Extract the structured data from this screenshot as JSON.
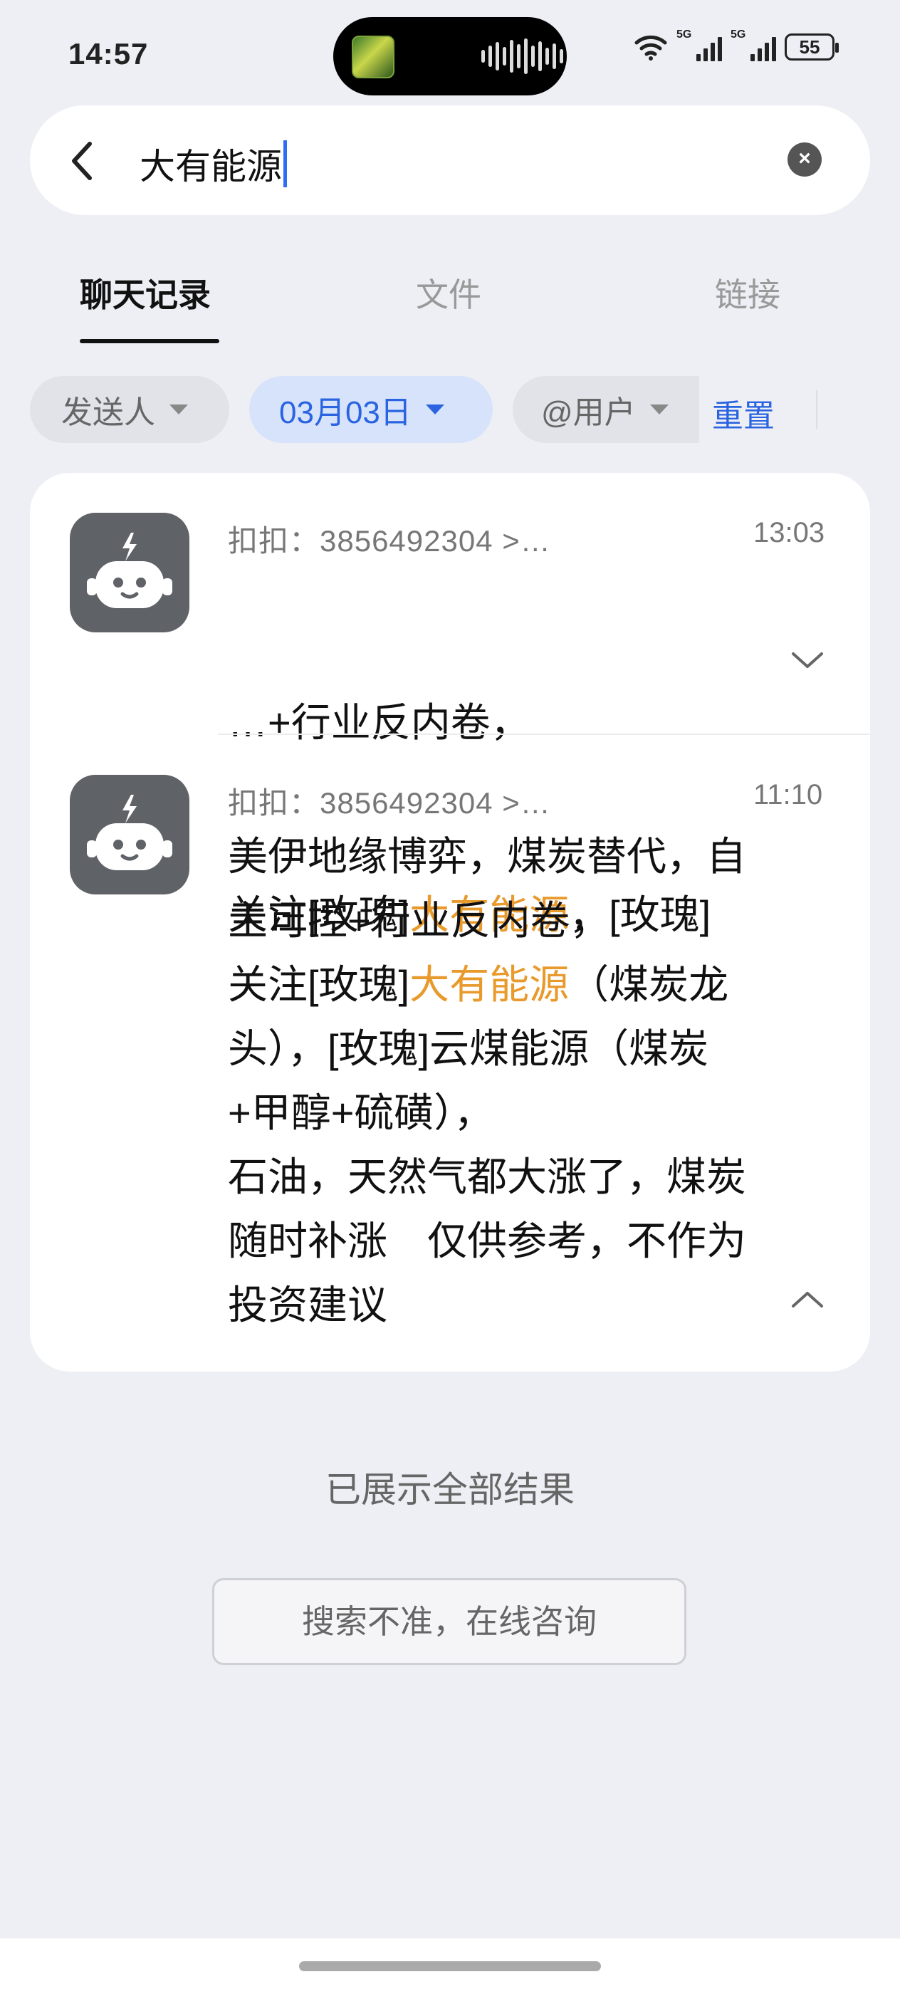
{
  "status_bar": {
    "time": "14:57",
    "network_1": "5G",
    "network_2": "5G",
    "battery": "55"
  },
  "search": {
    "query": "大有能源",
    "back_icon": "back-arrow-icon",
    "clear_icon": "clear-icon"
  },
  "tabs": [
    {
      "label": "聊天记录",
      "active": true
    },
    {
      "label": "文件",
      "active": false
    },
    {
      "label": "链接",
      "active": false
    }
  ],
  "filters": {
    "sender": "发送人",
    "date": "03月03日",
    "mention": "@用户",
    "reset": "重置"
  },
  "messages": [
    {
      "sender": "扣扣：3856492304 >…",
      "time": "13:03",
      "line1": "…+行业反内卷，",
      "line2_pre": "关注[玫瑰]",
      "line2_hl": "大有能源",
      "line2_post": "，[玫瑰]",
      "expanded": false
    },
    {
      "sender": "扣扣：3856492304 >…",
      "time": "11:10",
      "text_pre": "美伊地缘博弈，煤炭替代，自\n主可控+行业反内卷，\n关注[玫瑰]",
      "text_hl": "大有能源",
      "text_post": "（煤炭龙\n头），[玫瑰]云煤能源（煤炭\n+甲醇+硫磺），\n石油，天然气都大涨了，煤炭\n随时补涨　仅供参考，不作为\n投资建议",
      "expanded": true
    }
  ],
  "footer": {
    "all_shown": "已展示全部结果",
    "consult_button": "搜索不准，在线咨询"
  },
  "colors": {
    "accent": "#2a64e0",
    "highlight": "#e89a2c",
    "background": "#eeeff4"
  }
}
